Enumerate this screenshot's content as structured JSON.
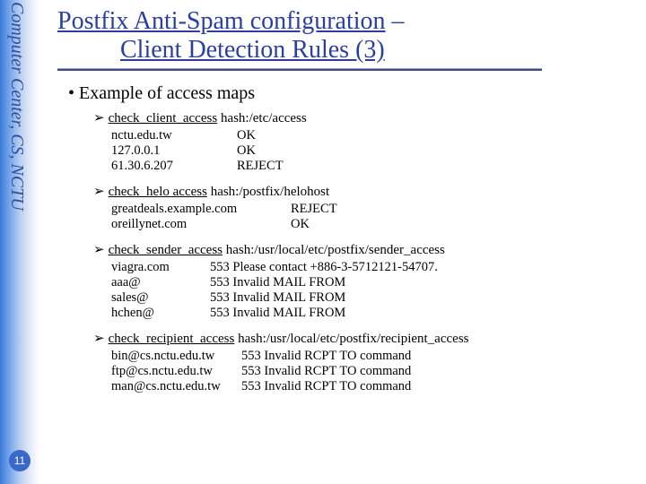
{
  "sidebar": {
    "vertical_label": "Computer Center, CS, NCTU",
    "page_number": "11"
  },
  "title": {
    "line1_a": "Postfix Anti-Spam configuration",
    "line1_b": " – ",
    "line2": "Client Detection Rules (3)"
  },
  "bullet_main": "Example of access maps",
  "sections": [
    {
      "cmd": "check_client_access",
      "rest": " hash:/etc/access",
      "rows": [
        {
          "k": "nctu.edu.tw",
          "v": "OK"
        },
        {
          "k": "127.0.0.1",
          "v": "OK"
        },
        {
          "k": "61.30.6.207",
          "v": "REJECT"
        }
      ]
    },
    {
      "cmd": "check_helo access",
      "rest": " hash:/postfix/helohost",
      "rows": [
        {
          "k": "greatdeals.example.com",
          "v": "REJECT"
        },
        {
          "k": "oreillynet.com",
          "v": "OK"
        }
      ]
    },
    {
      "cmd": "check_sender_access",
      "rest": " hash:/usr/local/etc/postfix/sender_access",
      "rows": [
        {
          "k": "viagra.com",
          "v": "553 Please contact +886-3-5712121-54707."
        },
        {
          "k": "aaa@",
          "v": "553 Invalid MAIL FROM"
        },
        {
          "k": "sales@",
          "v": "553 Invalid MAIL FROM"
        },
        {
          "k": "hchen@",
          "v": "553 Invalid MAIL FROM"
        }
      ]
    },
    {
      "cmd": "check_recipient_access",
      "rest": " hash:/usr/local/etc/postfix/recipient_access",
      "rows": [
        {
          "k": "bin@cs.nctu.edu.tw",
          "v": "553 Invalid RCPT TO command"
        },
        {
          "k": "ftp@cs.nctu.edu.tw",
          "v": "553 Invalid RCPT TO command"
        },
        {
          "k": "man@cs.nctu.edu.tw",
          "v": "553 Invalid RCPT TO command"
        }
      ]
    }
  ]
}
